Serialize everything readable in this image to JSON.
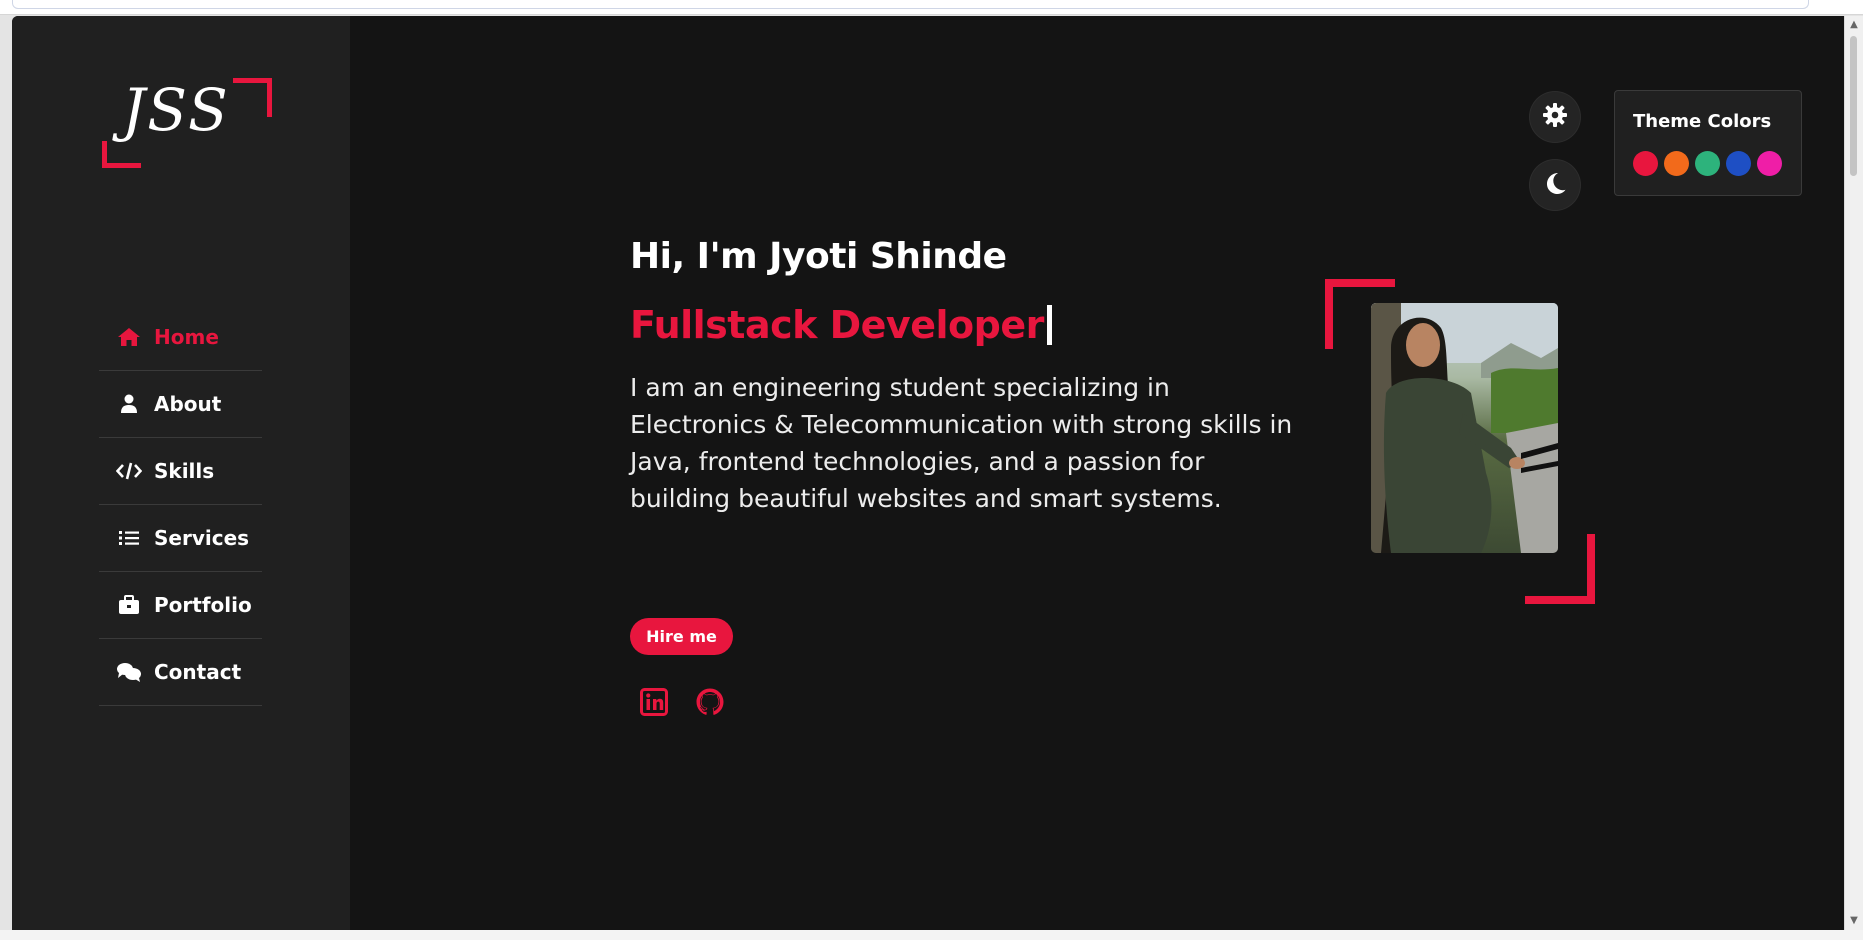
{
  "theme": {
    "accent": "#e8163e",
    "background": "#141414",
    "sidebar_bg": "#202020"
  },
  "logo": {
    "text": "JSS"
  },
  "nav": {
    "items": [
      {
        "label": "Home",
        "icon": "home-icon",
        "active": true
      },
      {
        "label": "About",
        "icon": "user-icon",
        "active": false
      },
      {
        "label": "Skills",
        "icon": "code-icon",
        "active": false
      },
      {
        "label": "Services",
        "icon": "list-icon",
        "active": false
      },
      {
        "label": "Portfolio",
        "icon": "briefcase-icon",
        "active": false
      },
      {
        "label": "Contact",
        "icon": "comments-icon",
        "active": false
      }
    ]
  },
  "hero": {
    "greeting": "Hi, I'm Jyoti Shinde",
    "role": "Fullstack Developer",
    "description": "I am an engineering student specializing in Electronics & Telecommunication with strong skills in Java, frontend technologies, and a passion for building beautiful websites and smart systems.",
    "cta_label": "Hire me",
    "social": [
      "linkedin-icon",
      "github-icon"
    ]
  },
  "settings": {
    "title": "Theme Colors",
    "colors": [
      "#e8163e",
      "#f26a1b",
      "#2db37c",
      "#1e4fc4",
      "#ef1ea7"
    ],
    "gear": "gear-icon",
    "mode": "moon-icon"
  }
}
